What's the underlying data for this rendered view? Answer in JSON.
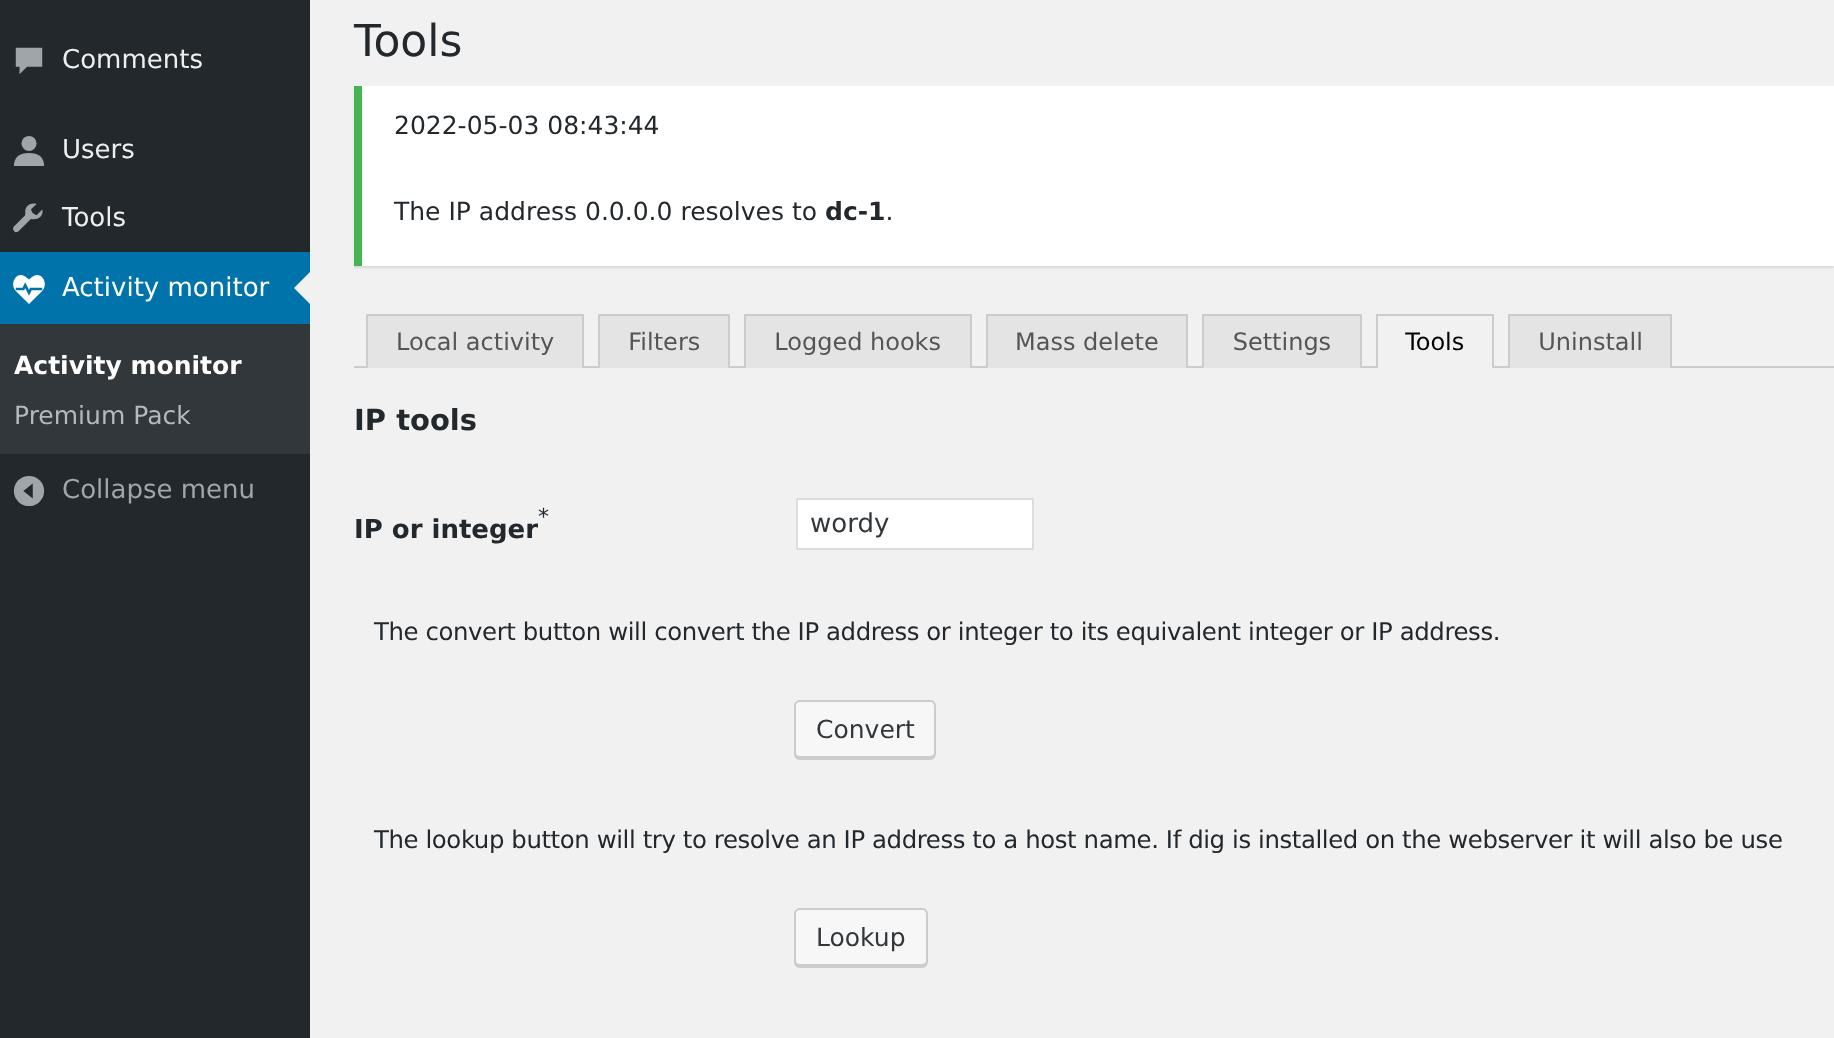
{
  "sidebar": {
    "items": [
      {
        "label": "Comments",
        "kind": "comment",
        "selected": false
      },
      {
        "label": "Users",
        "kind": "user",
        "selected": false
      },
      {
        "label": "Tools",
        "kind": "wrench",
        "selected": false
      },
      {
        "label": "Activity monitor",
        "kind": "heart",
        "selected": true,
        "submenu": [
          {
            "label": "Activity monitor",
            "selected": true
          },
          {
            "label": "Premium Pack",
            "selected": false
          }
        ]
      }
    ],
    "collapse": "Collapse menu"
  },
  "page_title": "Tools",
  "notice": {
    "time": "2022-05-03 08:43:44",
    "message": "The IP address 0.0.0.0 resolves to **dc-1**."
  },
  "tabs": [
    {
      "label": "Local activity",
      "selected": false
    },
    {
      "label": "Filters",
      "selected": false
    },
    {
      "label": "Logged hooks",
      "selected": false
    },
    {
      "label": "Mass delete",
      "selected": false
    },
    {
      "label": "Settings",
      "selected": false
    },
    {
      "label": "Tools",
      "selected": true
    },
    {
      "label": "Uninstall",
      "selected": false
    }
  ],
  "section_title": "IP tools",
  "field": {
    "label": "IP or integer",
    "required_mark": "*",
    "value": "wordy"
  },
  "convert": {
    "help": "The convert button will convert the IP address or integer to its equivalent integer or IP address.",
    "button": "Convert"
  },
  "lookup": {
    "help": "The lookup button will try to resolve an IP address to a host name. If dig is installed on the webserver it will also be use",
    "button": "Lookup"
  }
}
